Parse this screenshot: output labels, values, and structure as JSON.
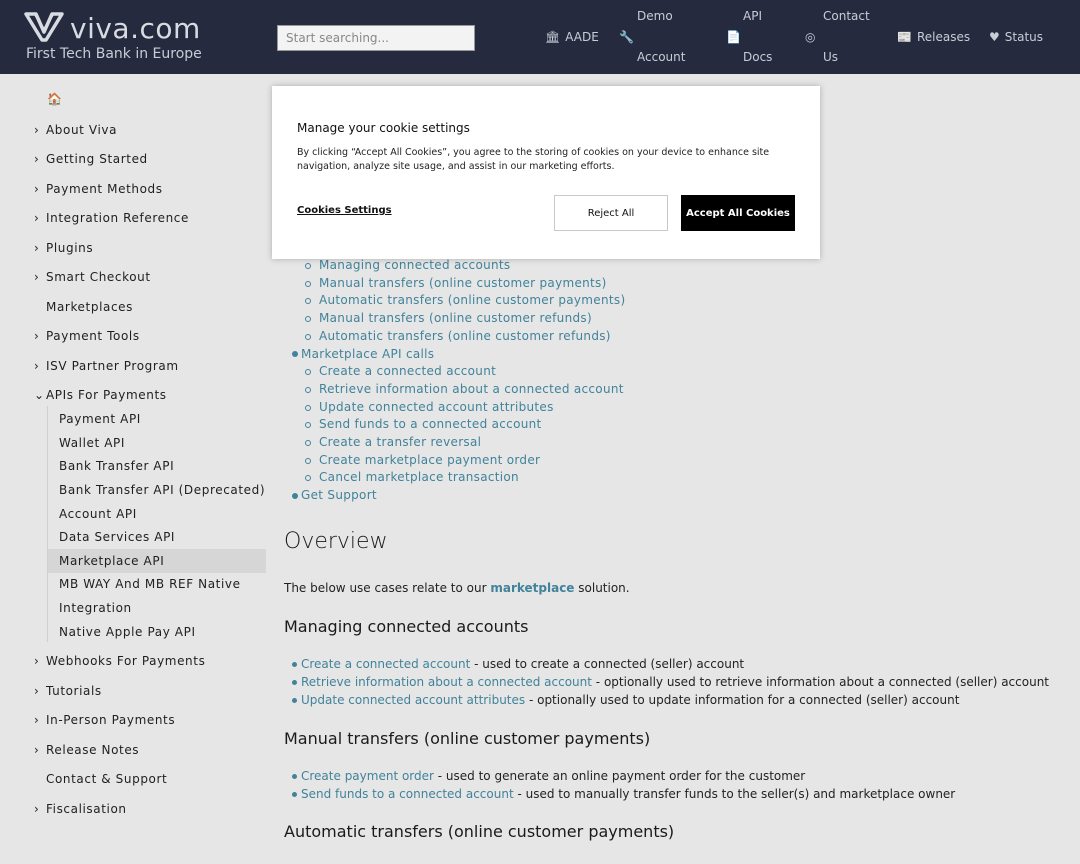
{
  "header": {
    "logo_text": "viva.com",
    "tagline": "First Tech Bank in Europe",
    "search_placeholder": "Start searching...",
    "nav": {
      "aade": "AADE",
      "demo_1": "Demo",
      "demo_2": "Account",
      "api_1": "API",
      "api_2": "Docs",
      "contact_1": "Contact",
      "contact_2": "Us",
      "releases": "Releases",
      "status": "Status"
    },
    "icons": {
      "aade": "🏛",
      "demo": "🔧",
      "api": "📄",
      "contact": "◎",
      "releases": "📰",
      "status": "♥"
    }
  },
  "sidebar": {
    "home_icon": "🏠",
    "items": [
      {
        "label": "About Viva"
      },
      {
        "label": "Getting Started"
      },
      {
        "label": "Payment Methods"
      },
      {
        "label": "Integration Reference"
      },
      {
        "label": "Plugins"
      },
      {
        "label": "Smart Checkout"
      },
      {
        "label": "Marketplaces"
      },
      {
        "label": "Payment Tools"
      },
      {
        "label": "ISV Partner Program"
      },
      {
        "label": "APIs For Payments"
      },
      {
        "label": "Webhooks For Payments"
      },
      {
        "label": "Tutorials"
      },
      {
        "label": "In-Person Payments"
      },
      {
        "label": "Release Notes"
      },
      {
        "label": "Contact & Support"
      },
      {
        "label": "Fiscalisation"
      }
    ],
    "sub_items": [
      {
        "label": "Payment API"
      },
      {
        "label": "Wallet API"
      },
      {
        "label": "Bank Transfer API"
      },
      {
        "label": "Bank Transfer API (Deprecated)"
      },
      {
        "label": "Account API"
      },
      {
        "label": "Data Services API"
      },
      {
        "label": "Marketplace API"
      },
      {
        "label": "MB WAY And MB REF Native"
      },
      {
        "label": "Integration"
      },
      {
        "label": "Native Apple Pay API"
      }
    ]
  },
  "toc": {
    "items": [
      "Managing connected accounts",
      "Manual transfers (online customer payments)",
      "Automatic transfers (online customer payments)",
      "Manual transfers (online customer refunds)",
      "Automatic transfers (online customer refunds)",
      "Marketplace API calls",
      "Create a connected account",
      "Retrieve information about a connected account",
      "Update connected account attributes",
      "Send funds to a connected account",
      "Create a transfer reversal",
      "Create marketplace payment order",
      "Cancel marketplace transaction",
      "Get Support"
    ]
  },
  "content": {
    "overview_title": "Overview",
    "overview_text_1": "The below use cases relate to our ",
    "overview_link": "marketplace",
    "overview_text_2": " solution.",
    "section1_title": "Managing connected accounts",
    "section1_items": [
      {
        "link": "Create a connected account",
        "text": " - used to create a connected (seller) account"
      },
      {
        "link": "Retrieve information about a connected account",
        "text": " - optionally used to retrieve information about a connected (seller) account"
      },
      {
        "link": "Update connected account attributes",
        "text": " - optionally used to update information for a connected (seller) account"
      }
    ],
    "section2_title": "Manual transfers (online customer payments)",
    "section2_items": [
      {
        "link": "Create payment order",
        "text": " - used to generate an online payment order for the customer"
      },
      {
        "link": "Send funds to a connected account",
        "text": " - used to manually transfer funds to the seller(s) and marketplace owner"
      }
    ],
    "section3_title": "Automatic transfers (online customer payments)"
  },
  "cookie_modal": {
    "title": "Manage your cookie settings",
    "body": "By clicking “Accept All Cookies”, you agree to the storing of cookies on your device to enhance site navigation, analyze site usage, and assist in our marketing efforts.",
    "settings_label": "Cookies Settings",
    "reject_label": "Reject All",
    "accept_label": "Accept All Cookies"
  },
  "colors": {
    "header_bg": "#262a3e",
    "link": "#41839a",
    "page_bg": "#e6e6e6"
  }
}
